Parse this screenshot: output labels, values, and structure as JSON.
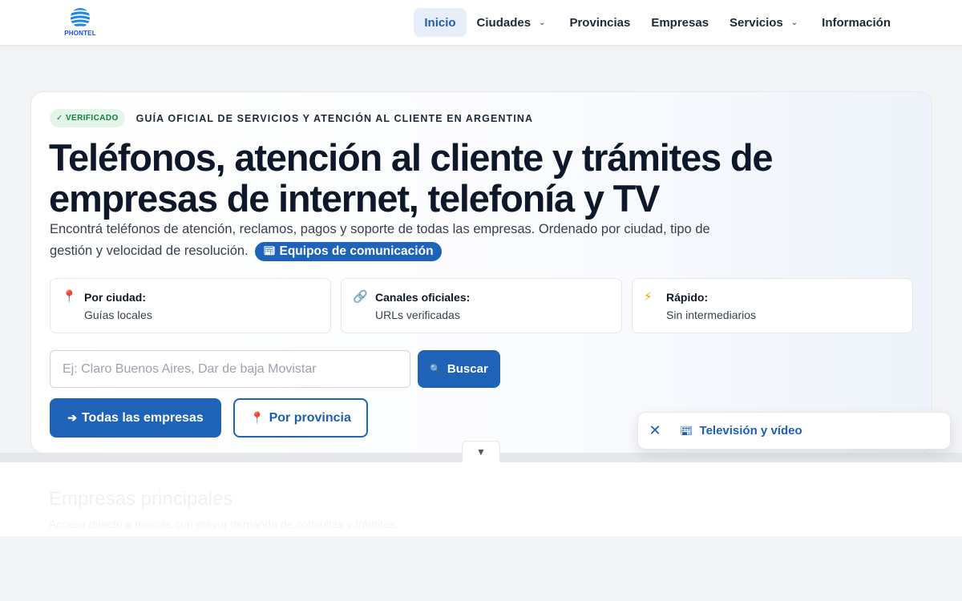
{
  "header": {
    "logo_text": "PHONTEL",
    "nav": [
      {
        "label": "Inicio"
      },
      {
        "label": "Ciudades"
      },
      {
        "label": "Provincias"
      },
      {
        "label": "Empresas"
      },
      {
        "label": "Servicios"
      },
      {
        "label": "Información"
      }
    ]
  },
  "hero": {
    "verified_badge": "✓ VERIFICADO",
    "eyebrow": "GUÍA OFICIAL DE SERVICIOS Y ATENCIÓN AL CLIENTE EN ARGENTINA",
    "title": "Teléfonos, atención al cliente y trámites de empresas de internet, telefonía y TV",
    "lead": "Encontrá teléfonos de atención, reclamos, pagos y soporte de todas las empresas. Ordenado por ciudad, tipo de gestión y velocidad de resolución.",
    "pill": "Equipos de comunicación",
    "features": [
      {
        "title": "Por ciudad:",
        "sub": "Guías locales",
        "icon": "pin-icon"
      },
      {
        "title": "Canales oficiales:",
        "sub": "URLs verificadas",
        "icon": "link-icon"
      },
      {
        "title": "Rápido:",
        "sub": "Sin intermediarios",
        "icon": "lightning-icon"
      }
    ],
    "search": {
      "placeholder": "Ej: Claro Buenos Aires, Dar de baja Movistar",
      "value": "",
      "button": "Buscar"
    },
    "cta_primary": "Todas las empresas",
    "cta_secondary": "Por provincia"
  },
  "lower": {
    "title": "Empresas principales",
    "subtitle": "Acceso directo a marcas con mayor demanda de consultas y trámites."
  },
  "toast": {
    "text": "Televisión y vídeo"
  },
  "colors": {
    "accent": "#1e63b8",
    "verified_bg": "#e4f6ea",
    "verified_fg": "#15803d",
    "nav_active_bg": "#e8eef9"
  }
}
